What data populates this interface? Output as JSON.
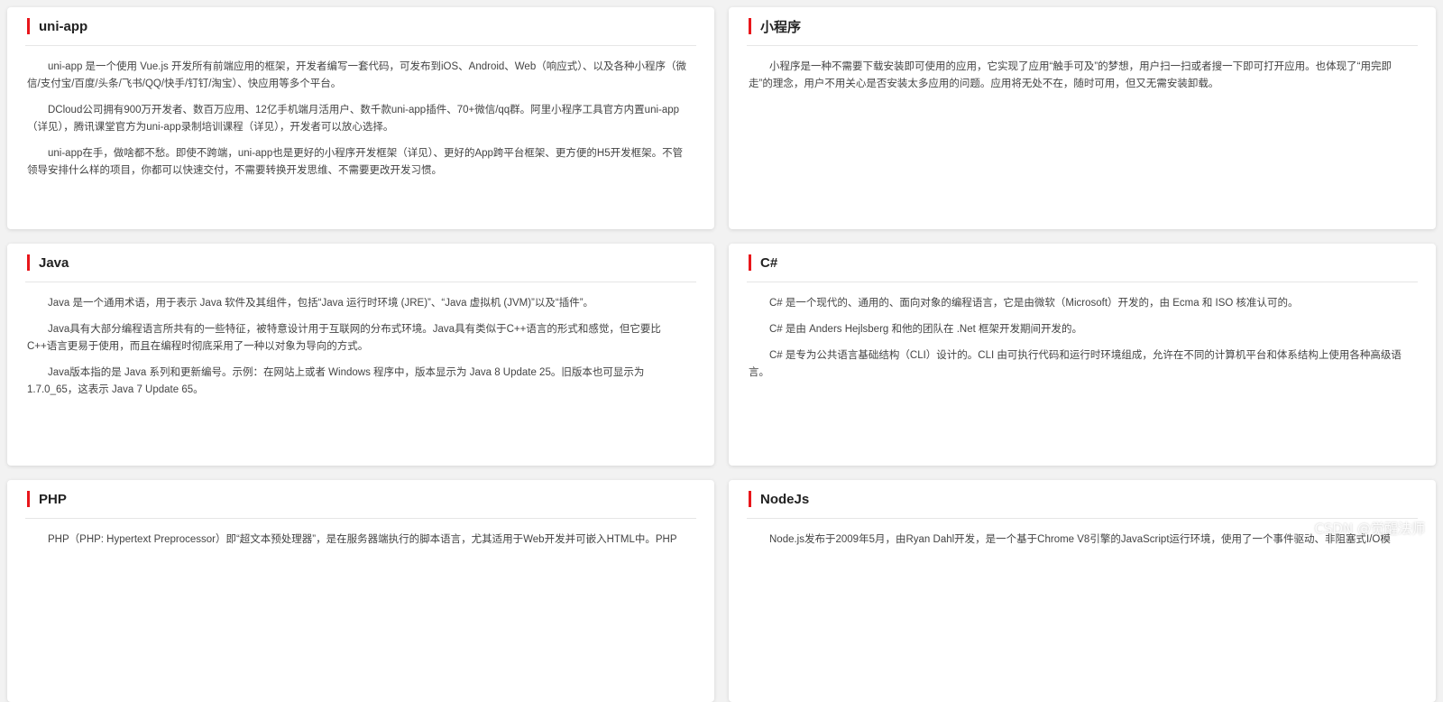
{
  "cards": [
    {
      "title": "uni-app",
      "paragraphs": [
        "uni-app 是一个使用 Vue.js 开发所有前端应用的框架，开发者编写一套代码，可发布到iOS、Android、Web（响应式）、以及各种小程序（微信/支付宝/百度/头条/飞书/QQ/快手/钉钉/淘宝）、快应用等多个平台。",
        "DCloud公司拥有900万开发者、数百万应用、12亿手机端月活用户、数千款uni-app插件、70+微信/qq群。阿里小程序工具官方内置uni-app（详见），腾讯课堂官方为uni-app录制培训课程（详见），开发者可以放心选择。",
        "uni-app在手，做啥都不愁。即使不跨端，uni-app也是更好的小程序开发框架（详见）、更好的App跨平台框架、更方便的H5开发框架。不管领导安排什么样的项目，你都可以快速交付，不需要转换开发思维、不需要更改开发习惯。"
      ]
    },
    {
      "title": "小程序",
      "paragraphs": [
        "小程序是一种不需要下载安装即可使用的应用，它实现了应用“触手可及”的梦想，用户扫一扫或者搜一下即可打开应用。也体现了“用完即走”的理念，用户不用关心是否安装太多应用的问题。应用将无处不在，随时可用，但又无需安装卸载。"
      ]
    },
    {
      "title": "Java",
      "paragraphs": [
        "Java 是一个通用术语，用于表示 Java 软件及其组件，包括“Java 运行时环境 (JRE)”、“Java 虚拟机 (JVM)”以及“插件”。",
        "Java具有大部分编程语言所共有的一些特征，被特意设计用于互联网的分布式环境。Java具有类似于C++语言的形式和感觉，但它要比C++语言更易于使用，而且在编程时彻底采用了一种以对象为导向的方式。",
        "Java版本指的是 Java 系列和更新编号。示例：在网站上或者 Windows 程序中，版本显示为 Java 8 Update 25。旧版本也可显示为 1.7.0_65，这表示 Java 7 Update 65。"
      ]
    },
    {
      "title": "C#",
      "paragraphs": [
        "C# 是一个现代的、通用的、面向对象的编程语言，它是由微软（Microsoft）开发的，由 Ecma 和 ISO 核准认可的。",
        "C# 是由 Anders Hejlsberg 和他的团队在 .Net 框架开发期间开发的。",
        "C# 是专为公共语言基础结构（CLI）设计的。CLI 由可执行代码和运行时环境组成，允许在不同的计算机平台和体系结构上使用各种高级语言。"
      ]
    },
    {
      "title": "PHP",
      "paragraphs": [
        "PHP（PHP: Hypertext Preprocessor）即“超文本预处理器”，是在服务器端执行的脚本语言，尤其适用于Web开发并可嵌入HTML中。PHP"
      ]
    },
    {
      "title": "NodeJs",
      "paragraphs": [
        "Node.js发布于2009年5月，由Ryan Dahl开发，是一个基于Chrome V8引擎的JavaScript运行环境，使用了一个事件驱动、非阻塞式I/O模"
      ]
    }
  ],
  "watermark": "CSDN @觉醒法师",
  "colors": {
    "accent": "#e8161b",
    "background": "#f2f2f2",
    "card": "#ffffff"
  }
}
